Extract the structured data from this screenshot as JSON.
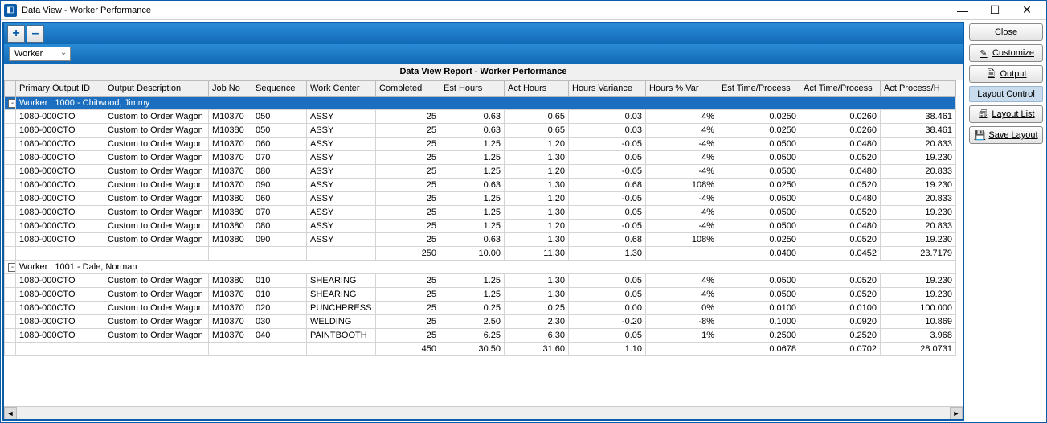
{
  "window": {
    "title": "Data View - Worker Performance"
  },
  "toolbar": {
    "plus": "+",
    "minus": "–"
  },
  "grouping": {
    "field": "Worker"
  },
  "report": {
    "title": "Data View Report - Worker Performance"
  },
  "columns": [
    "Primary Output ID",
    "Output Description",
    "Job No",
    "Sequence",
    "Work Center",
    "Completed",
    "Est Hours",
    "Act Hours",
    "Hours Variance",
    "Hours % Var",
    "Est Time/Process",
    "Act Time/Process",
    "Act Process/H"
  ],
  "groups": [
    {
      "header": "Worker : 1000 - Chitwood, Jimmy",
      "selected": true,
      "rows": [
        [
          "1080-000CTO",
          "Custom to Order Wagon",
          "M10370",
          "050",
          "ASSY",
          "25",
          "0.63",
          "0.65",
          "0.03",
          "4%",
          "0.0250",
          "0.0260",
          "38.461"
        ],
        [
          "1080-000CTO",
          "Custom to Order Wagon",
          "M10380",
          "050",
          "ASSY",
          "25",
          "0.63",
          "0.65",
          "0.03",
          "4%",
          "0.0250",
          "0.0260",
          "38.461"
        ],
        [
          "1080-000CTO",
          "Custom to Order Wagon",
          "M10370",
          "060",
          "ASSY",
          "25",
          "1.25",
          "1.20",
          "-0.05",
          "-4%",
          "0.0500",
          "0.0480",
          "20.833"
        ],
        [
          "1080-000CTO",
          "Custom to Order Wagon",
          "M10370",
          "070",
          "ASSY",
          "25",
          "1.25",
          "1.30",
          "0.05",
          "4%",
          "0.0500",
          "0.0520",
          "19.230"
        ],
        [
          "1080-000CTO",
          "Custom to Order Wagon",
          "M10370",
          "080",
          "ASSY",
          "25",
          "1.25",
          "1.20",
          "-0.05",
          "-4%",
          "0.0500",
          "0.0480",
          "20.833"
        ],
        [
          "1080-000CTO",
          "Custom to Order Wagon",
          "M10370",
          "090",
          "ASSY",
          "25",
          "0.63",
          "1.30",
          "0.68",
          "108%",
          "0.0250",
          "0.0520",
          "19.230"
        ],
        [
          "1080-000CTO",
          "Custom to Order Wagon",
          "M10380",
          "060",
          "ASSY",
          "25",
          "1.25",
          "1.20",
          "-0.05",
          "-4%",
          "0.0500",
          "0.0480",
          "20.833"
        ],
        [
          "1080-000CTO",
          "Custom to Order Wagon",
          "M10380",
          "070",
          "ASSY",
          "25",
          "1.25",
          "1.30",
          "0.05",
          "4%",
          "0.0500",
          "0.0520",
          "19.230"
        ],
        [
          "1080-000CTO",
          "Custom to Order Wagon",
          "M10380",
          "080",
          "ASSY",
          "25",
          "1.25",
          "1.20",
          "-0.05",
          "-4%",
          "0.0500",
          "0.0480",
          "20.833"
        ],
        [
          "1080-000CTO",
          "Custom to Order Wagon",
          "M10380",
          "090",
          "ASSY",
          "25",
          "0.63",
          "1.30",
          "0.68",
          "108%",
          "0.0250",
          "0.0520",
          "19.230"
        ]
      ],
      "subtotal": [
        "",
        "",
        "",
        "",
        "",
        "250",
        "10.00",
        "11.30",
        "1.30",
        "",
        "0.0400",
        "0.0452",
        "23.7179"
      ]
    },
    {
      "header": "Worker : 1001 - Dale, Norman",
      "selected": false,
      "rows": [
        [
          "1080-000CTO",
          "Custom to Order Wagon",
          "M10380",
          "010",
          "SHEARING",
          "25",
          "1.25",
          "1.30",
          "0.05",
          "4%",
          "0.0500",
          "0.0520",
          "19.230"
        ],
        [
          "1080-000CTO",
          "Custom to Order Wagon",
          "M10370",
          "010",
          "SHEARING",
          "25",
          "1.25",
          "1.30",
          "0.05",
          "4%",
          "0.0500",
          "0.0520",
          "19.230"
        ],
        [
          "1080-000CTO",
          "Custom to Order Wagon",
          "M10370",
          "020",
          "PUNCHPRESS",
          "25",
          "0.25",
          "0.25",
          "0.00",
          "0%",
          "0.0100",
          "0.0100",
          "100.000"
        ],
        [
          "1080-000CTO",
          "Custom to Order Wagon",
          "M10370",
          "030",
          "WELDING",
          "25",
          "2.50",
          "2.30",
          "-0.20",
          "-8%",
          "0.1000",
          "0.0920",
          "10.869"
        ],
        [
          "1080-000CTO",
          "Custom to Order Wagon",
          "M10370",
          "040",
          "PAINTBOOTH",
          "25",
          "6.25",
          "6.30",
          "0.05",
          "1%",
          "0.2500",
          "0.2520",
          "3.968"
        ]
      ],
      "subtotal": [
        "",
        "",
        "",
        "",
        "",
        "450",
        "30.50",
        "31.60",
        "1.10",
        "",
        "0.0678",
        "0.0702",
        "28.0731"
      ]
    }
  ],
  "side": {
    "close": "Close",
    "customize": "Customize",
    "output": "Output",
    "layout_header": "Layout Control",
    "layout_list": "Layout List",
    "save_layout": "Save Layout"
  }
}
